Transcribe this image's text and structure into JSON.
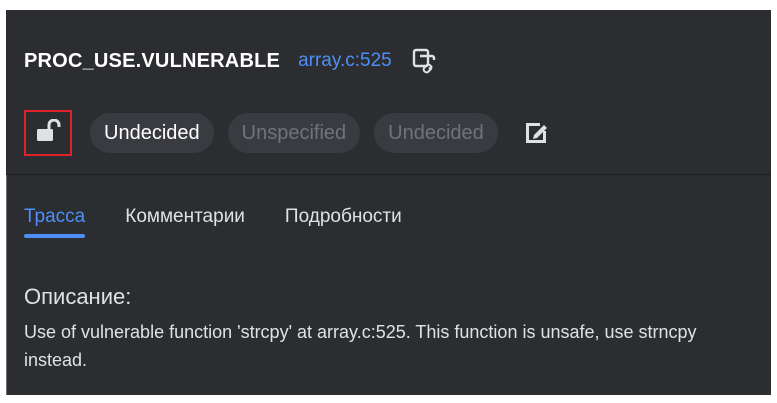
{
  "issue": {
    "checker": "PROC_USE.VULNERABLE",
    "location": "array.c:525"
  },
  "status": {
    "lock_icon": "unlock-icon",
    "pills": [
      "Undecided",
      "Unspecified",
      "Undecided"
    ],
    "edit_icon": "edit-icon"
  },
  "tabs": [
    "Трасса",
    "Комментарии",
    "Подробности"
  ],
  "description": {
    "title": "Описание:",
    "text": "Use of vulnerable function 'strcpy' at array.c:525. This function is unsafe, use strncpy instead."
  },
  "colors": {
    "panel_bg": "#2b2d30",
    "accent": "#4e8ff7",
    "highlight_border": "#e0202a"
  }
}
